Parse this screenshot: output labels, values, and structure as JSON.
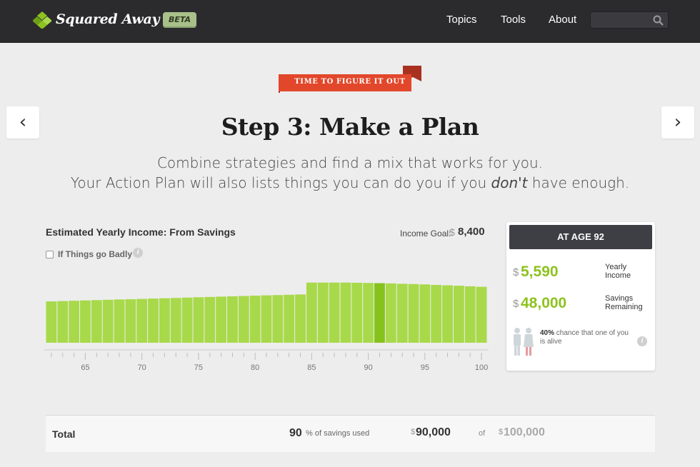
{
  "header": {
    "brand": "Squared Away",
    "badge": "BETA",
    "nav": [
      "Topics",
      "Tools",
      "About"
    ],
    "search_placeholder": ""
  },
  "hero": {
    "ribbon": "TIME TO FIGURE IT OUT",
    "title": "Step 3: Make a Plan",
    "line1": "Combine strategies and find a mix that works for you.",
    "line2_pre": "Your Action Plan will also lists things you can do you if you ",
    "line2_em": "don't",
    "line2_post": " have enough.",
    "prev_icon": "‹",
    "next_icon": "›"
  },
  "chart_panel": {
    "title": "Estimated Yearly Income: From Savings",
    "goal_label": "Income Goal:",
    "goal_currency": "$",
    "goal_value": "8,400",
    "checkbox_label": "If Things go Badly",
    "info": "i"
  },
  "chart_data": {
    "type": "bar",
    "x": [
      62,
      63,
      64,
      65,
      66,
      67,
      68,
      69,
      70,
      71,
      72,
      73,
      74,
      75,
      76,
      77,
      78,
      79,
      80,
      81,
      82,
      83,
      84,
      85,
      86,
      87,
      88,
      89,
      90,
      91,
      92,
      93,
      94,
      95,
      96,
      97,
      98,
      99,
      100
    ],
    "values": [
      5120,
      5160,
      5200,
      5240,
      5280,
      5320,
      5360,
      5390,
      5430,
      5470,
      5510,
      5550,
      5590,
      5630,
      5670,
      5710,
      5750,
      5790,
      5830,
      5870,
      5900,
      5940,
      5980,
      7450,
      7450,
      7450,
      7450,
      7430,
      7400,
      7380,
      7350,
      7300,
      7270,
      7220,
      7160,
      7110,
      7060,
      6990,
      6930
    ],
    "highlight_x": 91,
    "ticks": [
      65,
      70,
      75,
      80,
      85,
      90,
      95,
      100
    ],
    "ylim": [
      0,
      8400
    ],
    "colors": {
      "bar": "#a8d94a",
      "highlight": "#86c21c"
    }
  },
  "age_card": {
    "header": "AT AGE 92",
    "currency": "$",
    "income_value": "5,590",
    "income_label_1": "Yearly",
    "income_label_2": "Income",
    "savings_value": "48,000",
    "savings_label_1": "Savings",
    "savings_label_2": "Remaining",
    "chance_pct": "40%",
    "chance_text": " chance that one of you is alive",
    "info": "i"
  },
  "totals": {
    "label": "Total",
    "pct_value": "90",
    "pct_label": "% of savings used",
    "currency": "$",
    "used_value": "90,000",
    "of_label": "of",
    "available_value": "100,000"
  }
}
